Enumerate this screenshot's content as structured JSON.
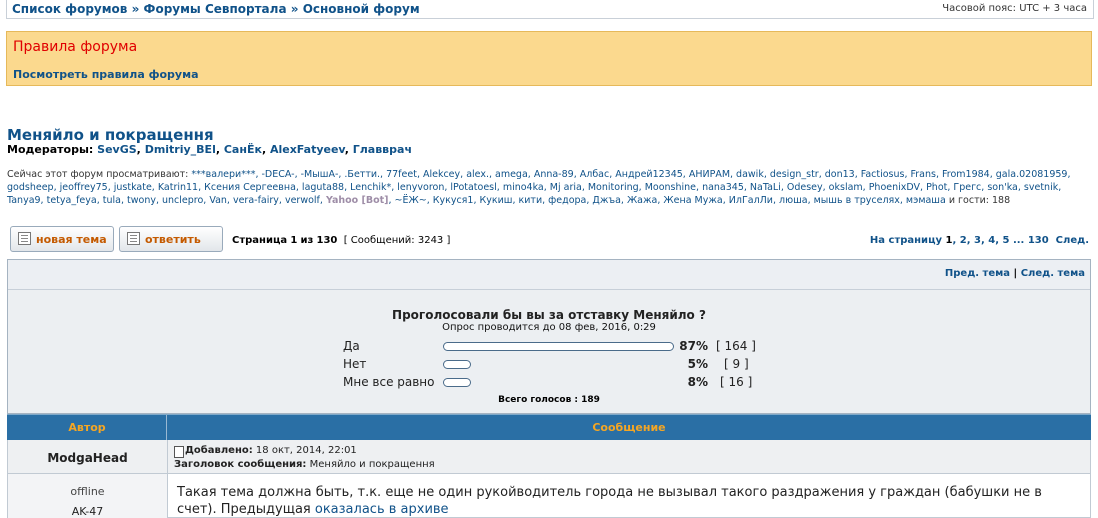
{
  "breadcrumb": {
    "items": [
      "Список форумов",
      "Форумы Севпортала",
      "Основной форум"
    ],
    "separator": "»"
  },
  "timezone": "Часовой пояс: UTC + 3 часа",
  "rules": {
    "title": "Правила форума",
    "link": "Посмотреть правила форума"
  },
  "forum": {
    "title": "Меняйло и покращення",
    "moderators_label": "Модераторы:",
    "moderators": [
      "SevGS",
      "Dmitriy_BEl",
      "СанЁк",
      "AlexFatyeev",
      "Главврач"
    ],
    "viewers_prefix": "Сейчас этот форум просматривают:",
    "viewers_part1": "***валери***, -DECA-, -МышА-, .Бетти., 77feet, Alekcey, alex., amega, Anna-89, Албас, Андрей12345, АНИРАМ, dawik, design_str, don13, Factiosus, Frans, From1984, gala.02081959, godsheep, jeoffrey75, justkate, Katrin11, Ксения Сергеевна, laguta88, Lenchik*, lenyvoron, lPotatoesl, mino4ka, Mj aria, Monitoring, Moonshine, nana345, NaTaLi, Odesey, okslam, PhoenixDV, Phot, Грегс, son'ka, svetnik, Tanya9, tetya_feya, tula, twony, unclepro, Van, vera-fairy, verwolf,",
    "viewers_bot": "Yahoo [Bot]",
    "viewers_part2": ", ~ЁЖ~, Кукуся1, Кукиш, кити, федора, Джъа, Жажа, Жена Мужа, ИлГалЛи, люша, мышь в труселях, мэмаша",
    "viewers_guests": "и гости: 188"
  },
  "toolbar": {
    "new_topic": "новая тема",
    "reply": "ответить",
    "page_text_prefix": "Страница",
    "page_current": "1",
    "page_of": "из",
    "page_total": "130",
    "messages_text": "[ Сообщений: 3243 ]"
  },
  "pager": {
    "prefix": "На страницу",
    "pages": [
      "1",
      "2",
      "3",
      "4",
      "5"
    ],
    "ellipsis": "...",
    "last": "130",
    "next": "След."
  },
  "topic_nav": {
    "prev": "Пред. тема",
    "separator": "|",
    "next": "След. тема"
  },
  "poll": {
    "question": "Проголосовали бы вы за отставку Меняйло ?",
    "subtitle": "Опрос проводится до 08 фев, 2016, 0:29",
    "options": [
      {
        "label": "Да",
        "percent": 87,
        "percent_text": "87%",
        "count_text": "[ 164 ]"
      },
      {
        "label": "Нет",
        "percent": 5,
        "percent_text": "5%",
        "count_text": "[ 9 ]"
      },
      {
        "label": "Мне все равно",
        "percent": 8,
        "percent_text": "8%",
        "count_text": "[ 16 ]"
      }
    ],
    "total": "Всего голосов : 189"
  },
  "table": {
    "col_author": "Автор",
    "col_message": "Сообщение"
  },
  "post": {
    "author": "ModgaHead",
    "posted_label": "Добавлено:",
    "posted_date": "18 окт, 2014, 22:01",
    "subject_label": "Заголовок сообщения:",
    "subject": "Меняйло и покращення",
    "status": "offline",
    "rank": "AK-47",
    "body_text": "Такая тема должна быть, т.к. еще не один рукойводитель города не вызывал такого раздражения у граждан (бабушки не в счет). Предыдущая",
    "body_link": "оказалась в архиве"
  },
  "colors": {
    "link": "#105289",
    "rules_bg": "#fbd98e",
    "rules_title": "#e00000",
    "table_head": "#2a6fa5",
    "table_head_text": "#f5a623",
    "button_label": "#c45a00"
  }
}
